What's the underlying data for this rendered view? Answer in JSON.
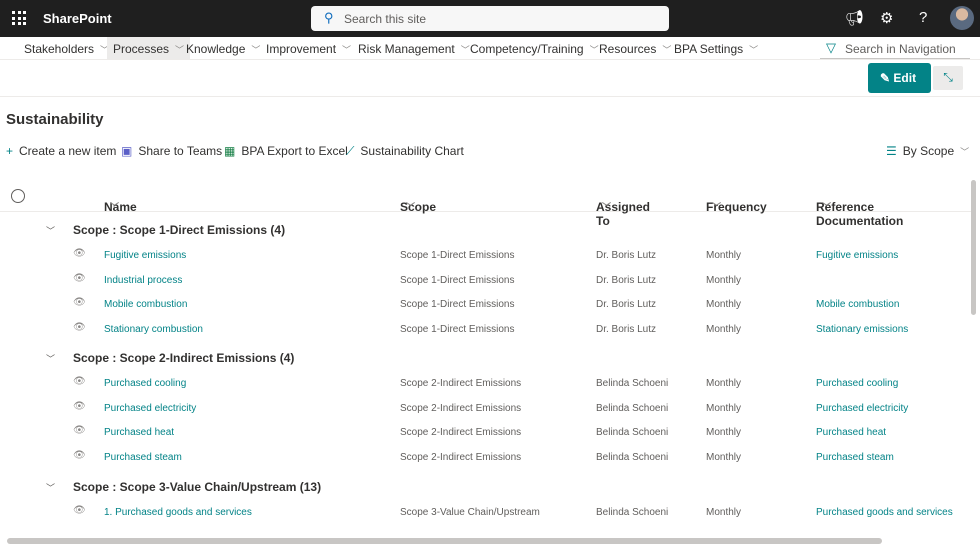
{
  "app": {
    "name": "SharePoint",
    "search_placeholder": "Search this site"
  },
  "topbar_icons": [
    "megaphone-icon",
    "gear-icon",
    "help-icon",
    "avatar"
  ],
  "nav": {
    "items": [
      "Stakeholders",
      "Processes",
      "Knowledge",
      "Improvement",
      "Risk Management",
      "Competency/Training",
      "Resources",
      "BPA Settings"
    ],
    "selected": "Processes",
    "search_placeholder": "Search in Navigation"
  },
  "edit_label": "Edit",
  "page_title": "Sustainability",
  "commands": [
    "Create a new item",
    "Share to Teams",
    "BPA Export to Excel",
    "Sustainability Chart"
  ],
  "view": "By Scope",
  "columns": [
    "Name",
    "Scope",
    "Assigned To",
    "Frequency",
    "Reference Documentation"
  ],
  "colors": {
    "accent": "#038387",
    "topbar": "#1f1f1f"
  },
  "groups": [
    {
      "label": "Scope : Scope 1-Direct Emissions (4)",
      "rows": [
        {
          "name": "Fugitive emissions",
          "scope": "Scope 1-Direct Emissions",
          "assigned": "Dr. Boris Lutz",
          "frequency": "Monthly",
          "ref": "Fugitive emissions"
        },
        {
          "name": "Industrial process",
          "scope": "Scope 1-Direct Emissions",
          "assigned": "Dr. Boris Lutz",
          "frequency": "Monthly",
          "ref": ""
        },
        {
          "name": "Mobile combustion",
          "scope": "Scope 1-Direct Emissions",
          "assigned": "Dr. Boris Lutz",
          "frequency": "Monthly",
          "ref": "Mobile combustion"
        },
        {
          "name": "Stationary combustion",
          "scope": "Scope 1-Direct Emissions",
          "assigned": "Dr. Boris Lutz",
          "frequency": "Monthly",
          "ref": "Stationary emissions"
        }
      ]
    },
    {
      "label": "Scope : Scope 2-Indirect Emissions (4)",
      "rows": [
        {
          "name": "Purchased cooling",
          "scope": "Scope 2-Indirect Emissions",
          "assigned": "Belinda Schoeni",
          "frequency": "Monthly",
          "ref": "Purchased cooling"
        },
        {
          "name": "Purchased electricity",
          "scope": "Scope 2-Indirect Emissions",
          "assigned": "Belinda Schoeni",
          "frequency": "Monthly",
          "ref": "Purchased electricity"
        },
        {
          "name": "Purchased heat",
          "scope": "Scope 2-Indirect Emissions",
          "assigned": "Belinda Schoeni",
          "frequency": "Monthly",
          "ref": "Purchased heat"
        },
        {
          "name": "Purchased steam",
          "scope": "Scope 2-Indirect Emissions",
          "assigned": "Belinda Schoeni",
          "frequency": "Monthly",
          "ref": "Purchased steam"
        }
      ]
    },
    {
      "label": "Scope : Scope 3-Value Chain/Upstream (13)",
      "rows": [
        {
          "name": "1. Purchased goods and services",
          "scope": "Scope 3-Value Chain/Upstream",
          "assigned": "Belinda Schoeni",
          "frequency": "Monthly",
          "ref": "Purchased goods and services"
        }
      ]
    }
  ]
}
